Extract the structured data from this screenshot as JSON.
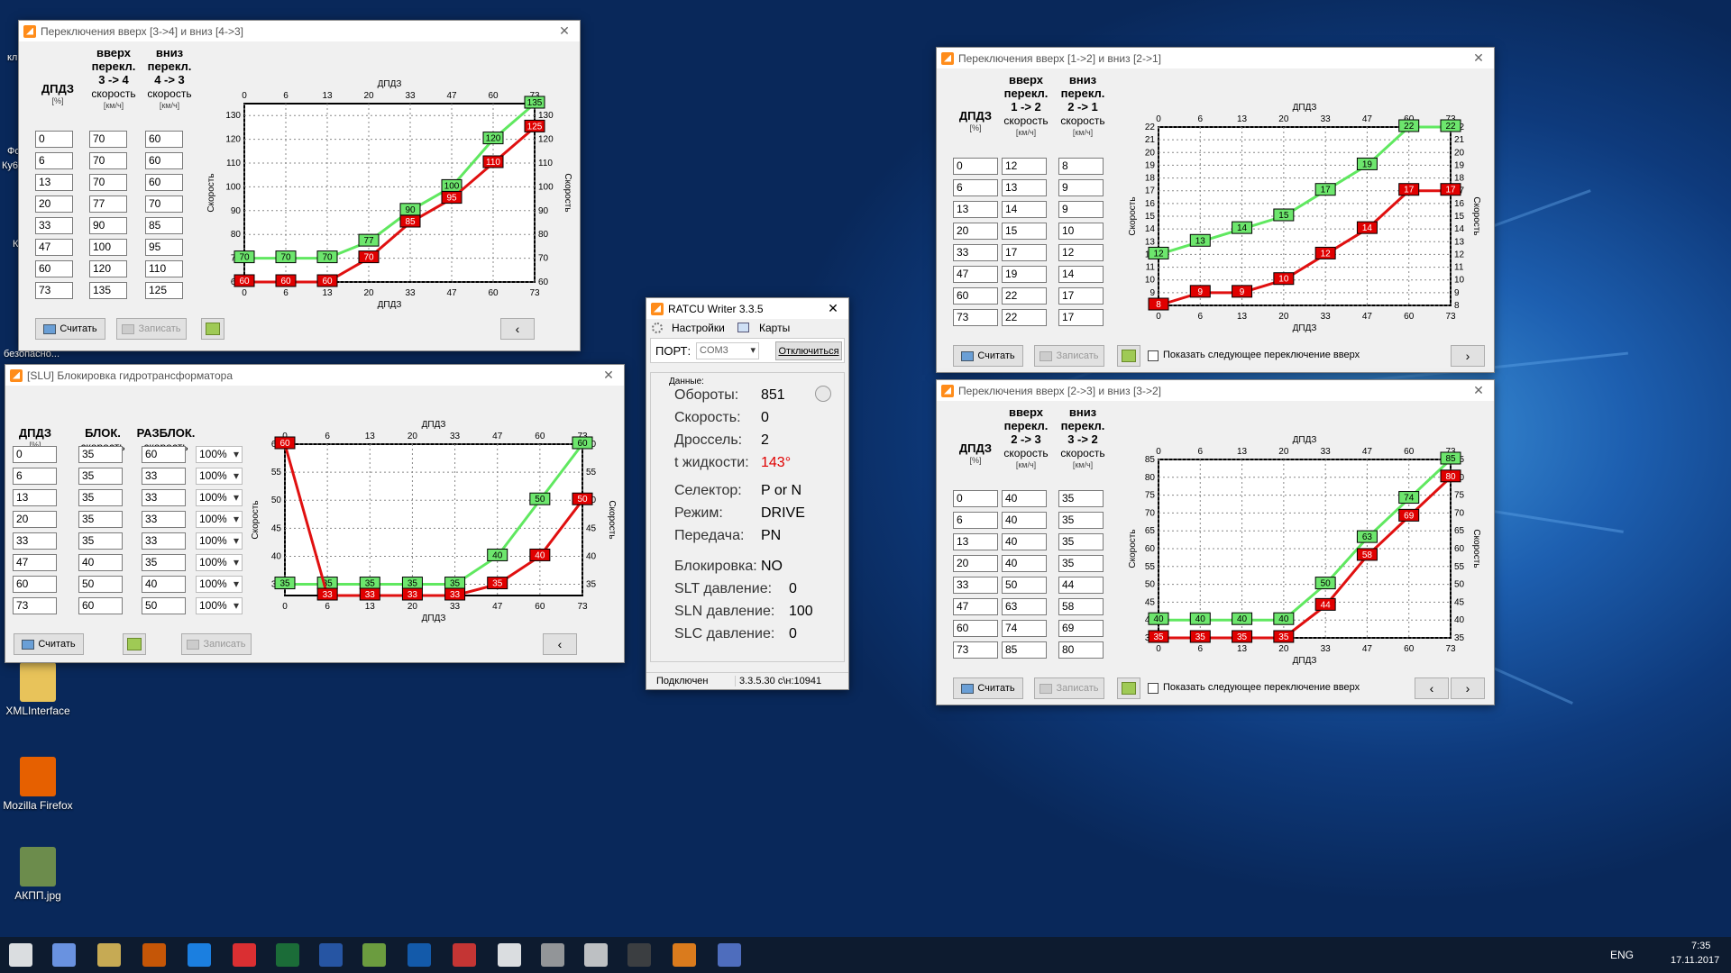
{
  "desktop": {
    "icons": [
      {
        "label": "XMLInterface",
        "top": 735,
        "left": 0,
        "color": "#e8c35a"
      },
      {
        "label": "Mozilla Firefox",
        "top": 840,
        "left": 0,
        "color": "#e66000"
      },
      {
        "label": "АКПП.jpg",
        "top": 940,
        "left": 0,
        "color": "#6c8c4c"
      }
    ],
    "clipped_labels": [
      {
        "text": "кл",
        "top": 58,
        "left": 8
      },
      {
        "text": "Фо",
        "top": 162,
        "left": 8
      },
      {
        "text": "Ку6",
        "top": 178,
        "left": 2
      },
      {
        "text": "Ко",
        "top": 265,
        "left": 14
      },
      {
        "text": "L",
        "top": 372,
        "left": 20
      },
      {
        "text": "безопасно...",
        "top": 387,
        "left": 4
      }
    ]
  },
  "win34": {
    "title": "Переключения вверх [3->4] и вниз [4->3]",
    "col1": {
      "head": "ДПДЗ",
      "unit": "[%]"
    },
    "col2": {
      "head": "вверх перекл.",
      "dir": "3 -> 4",
      "sub": "скорость",
      "unit": "[км/ч]"
    },
    "col3": {
      "head": "вниз перекл.",
      "dir": "4 -> 3",
      "sub": "скорость",
      "unit": "[км/ч]"
    },
    "rows": [
      [
        "0",
        "70",
        "60"
      ],
      [
        "6",
        "70",
        "60"
      ],
      [
        "13",
        "70",
        "60"
      ],
      [
        "20",
        "77",
        "70"
      ],
      [
        "33",
        "90",
        "85"
      ],
      [
        "47",
        "100",
        "95"
      ],
      [
        "60",
        "120",
        "110"
      ],
      [
        "73",
        "135",
        "125"
      ]
    ],
    "btn_read": "Считать",
    "btn_write": "Записать",
    "nav": "‹"
  },
  "win12": {
    "title": "Переключения вверх [1->2] и вниз [2->1]",
    "col1": {
      "head": "ДПДЗ",
      "unit": "[%]"
    },
    "col2": {
      "head": "вверх перекл.",
      "dir": "1 -> 2",
      "sub": "скорость",
      "unit": "[км/ч]"
    },
    "col3": {
      "head": "вниз перекл.",
      "dir": "2 -> 1",
      "sub": "скорость",
      "unit": "[км/ч]"
    },
    "rows": [
      [
        "0",
        "12",
        "8"
      ],
      [
        "6",
        "13",
        "9"
      ],
      [
        "13",
        "14",
        "9"
      ],
      [
        "20",
        "15",
        "10"
      ],
      [
        "33",
        "17",
        "12"
      ],
      [
        "47",
        "19",
        "14"
      ],
      [
        "60",
        "22",
        "17"
      ],
      [
        "73",
        "22",
        "17"
      ]
    ],
    "btn_read": "Считать",
    "btn_write": "Записать",
    "show_next": "Показать следующее переключение вверх",
    "nav_next": "›"
  },
  "win23": {
    "title": "Переключения вверх [2->3] и вниз [3->2]",
    "col1": {
      "head": "ДПДЗ",
      "unit": "[%]"
    },
    "col2": {
      "head": "вверх перекл.",
      "dir": "2 -> 3",
      "sub": "скорость",
      "unit": "[км/ч]"
    },
    "col3": {
      "head": "вниз перекл.",
      "dir": "3 -> 2",
      "sub": "скорость",
      "unit": "[км/ч]"
    },
    "rows": [
      [
        "0",
        "40",
        "35"
      ],
      [
        "6",
        "40",
        "35"
      ],
      [
        "13",
        "40",
        "35"
      ],
      [
        "20",
        "40",
        "35"
      ],
      [
        "33",
        "50",
        "44"
      ],
      [
        "47",
        "63",
        "58"
      ],
      [
        "60",
        "74",
        "69"
      ],
      [
        "73",
        "85",
        "80"
      ]
    ],
    "btn_read": "Считать",
    "btn_write": "Записать",
    "show_next": "Показать следующее переключение вверх",
    "nav_prev": "‹",
    "nav_next": "›"
  },
  "winslu": {
    "title": "[SLU] Блокировка гидротрансформатора",
    "col1": {
      "head": "ДПДЗ",
      "unit": "[%]"
    },
    "col2": {
      "head": "БЛОК.",
      "sub": "скорость",
      "unit": "[км/ч]"
    },
    "col3": {
      "head": "РАЗБЛОК.",
      "sub": "скорость",
      "unit": "[км/ч]"
    },
    "rows": [
      [
        "0",
        "35",
        "60",
        "100%"
      ],
      [
        "6",
        "35",
        "33",
        "100%"
      ],
      [
        "13",
        "35",
        "33",
        "100%"
      ],
      [
        "20",
        "35",
        "33",
        "100%"
      ],
      [
        "33",
        "35",
        "33",
        "100%"
      ],
      [
        "47",
        "40",
        "35",
        "100%"
      ],
      [
        "60",
        "50",
        "40",
        "100%"
      ],
      [
        "73",
        "60",
        "50",
        "100%"
      ]
    ],
    "btn_read": "Считать",
    "btn_write": "Записать",
    "nav": "‹"
  },
  "ratcu": {
    "title": "RATCU Writer 3.3.5",
    "menu_settings": "Настройки",
    "menu_maps": "Карты",
    "port_label": "ПОРТ:",
    "port_value": "COM3",
    "disconnect": "Отключиться",
    "group": "Данные:",
    "fields": [
      {
        "label": "Обороты:",
        "value": "851",
        "color": "#000"
      },
      {
        "label": "Скорость:",
        "value": "0",
        "color": "#000"
      },
      {
        "label": "Дроссель:",
        "value": "2",
        "color": "#000"
      },
      {
        "label": "t жидкости:",
        "value": "143°",
        "color": "#e00000"
      },
      {
        "label": "Селектор:",
        "value": "P or N",
        "color": "#000"
      },
      {
        "label": "Режим:",
        "value": "DRIVE",
        "color": "#000"
      },
      {
        "label": "Передача:",
        "value": "PN",
        "color": "#000"
      },
      {
        "label": "Блокировка:",
        "value": "NO",
        "color": "#000"
      },
      {
        "label": "SLT давление:",
        "value": "0",
        "color": "#000"
      },
      {
        "label": "SLN давление:",
        "value": "100",
        "color": "#000"
      },
      {
        "label": "SLC давление:",
        "value": "0",
        "color": "#000"
      }
    ],
    "status_left": "Подключен",
    "status_right": "3.3.5.30  с\\н:10941"
  },
  "chart_data": [
    {
      "id": "c34",
      "type": "line",
      "title": "",
      "x_label": "ДПДЗ",
      "y_label": "Скорость",
      "x_ticks": [
        0,
        6,
        13,
        20,
        33,
        47,
        60,
        73
      ],
      "y_ticks": [
        60,
        70,
        80,
        90,
        100,
        110,
        120,
        130
      ],
      "ylim": [
        60,
        135
      ],
      "grid": true,
      "series": [
        {
          "name": "",
          "color": "#60e860",
          "values": [
            70,
            70,
            70,
            77,
            90,
            100,
            120,
            135
          ]
        },
        {
          "name": "",
          "color": "#e01010",
          "values": [
            60,
            60,
            60,
            70,
            85,
            95,
            110,
            125
          ]
        }
      ]
    },
    {
      "id": "cslu",
      "type": "line",
      "title": "",
      "x_label": "ДПДЗ",
      "y_label": "Скорость",
      "x_ticks": [
        0,
        6,
        13,
        20,
        33,
        47,
        60,
        73
      ],
      "y_ticks": [
        35,
        40,
        45,
        50,
        55,
        60
      ],
      "ylim": [
        33,
        60
      ],
      "grid": true,
      "series": [
        {
          "name": "",
          "color": "#60e860",
          "values": [
            35,
            35,
            35,
            35,
            35,
            40,
            50,
            60
          ]
        },
        {
          "name": "",
          "color": "#e01010",
          "values": [
            60,
            33,
            33,
            33,
            33,
            35,
            40,
            50
          ]
        }
      ]
    },
    {
      "id": "c12",
      "type": "line",
      "title": "",
      "x_label": "ДПДЗ",
      "y_label": "Скорость",
      "x_ticks": [
        0,
        6,
        13,
        20,
        33,
        47,
        60,
        73
      ],
      "y_ticks": [
        8,
        9,
        10,
        11,
        12,
        13,
        14,
        15,
        16,
        17,
        18,
        19,
        20,
        21,
        22
      ],
      "ylim": [
        8,
        22
      ],
      "grid": true,
      "series": [
        {
          "name": "",
          "color": "#60e860",
          "values": [
            12,
            13,
            14,
            15,
            17,
            19,
            22,
            22
          ]
        },
        {
          "name": "",
          "color": "#e01010",
          "values": [
            8,
            9,
            9,
            10,
            12,
            14,
            17,
            17
          ]
        }
      ]
    },
    {
      "id": "c23",
      "type": "line",
      "title": "",
      "x_label": "ДПДЗ",
      "y_label": "Скорость",
      "x_ticks": [
        0,
        6,
        13,
        20,
        33,
        47,
        60,
        73
      ],
      "y_ticks": [
        35,
        40,
        45,
        50,
        55,
        60,
        65,
        70,
        75,
        80,
        85
      ],
      "ylim": [
        35,
        85
      ],
      "grid": true,
      "series": [
        {
          "name": "",
          "color": "#60e860",
          "values": [
            40,
            40,
            40,
            40,
            50,
            63,
            74,
            85
          ]
        },
        {
          "name": "",
          "color": "#e01010",
          "values": [
            35,
            35,
            35,
            35,
            44,
            58,
            69,
            80
          ]
        }
      ]
    }
  ],
  "taskbar": {
    "lang": "ENG",
    "time": "7:35",
    "date": "17.11.2017"
  }
}
